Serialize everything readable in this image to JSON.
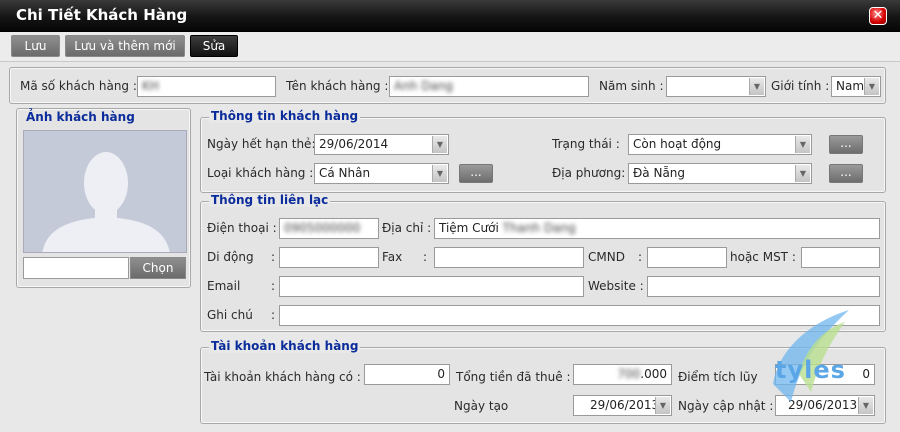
{
  "window": {
    "title": "Chi Tiết Khách Hàng"
  },
  "toolbar": {
    "save": "Lưu",
    "save_new": "Lưu và thêm mới",
    "edit": "Sửa"
  },
  "customer": {
    "code_label": "Mã số khách hàng :",
    "code_value": "KH",
    "name_label": "Tên khách hàng :",
    "name_value": "Anh Dang",
    "birth_label": "Năm sinh :",
    "birth_value": "",
    "gender_label": "Giới tính :",
    "gender_value": "Nam"
  },
  "photo": {
    "title": "Ảnh khách hàng",
    "file_value": "",
    "choose": "Chọn"
  },
  "info": {
    "title": "Thông tin khách hàng",
    "expiry_label": "Ngày hết hạn thẻ:",
    "expiry_value": "29/06/2014",
    "status_label": "Trạng thái :",
    "status_value": "Còn hoạt động",
    "type_label": "Loại khách hàng :",
    "type_value": "Cá Nhân",
    "locality_label": "Địa phương:",
    "locality_value": "Đà Nẵng",
    "ellipsis": "..."
  },
  "contact": {
    "title": "Thông tin liên lạc",
    "phone_label": "Điện thoại :",
    "phone_value": "0905000000",
    "address_label": "Địa chỉ :",
    "address_prefix": "Tiệm Cưới ",
    "address_blur": "Thanh Dang",
    "mobile_label": "Di động",
    "colon": ":",
    "fax_label": "Fax",
    "id_label": "CMND",
    "tax_label": "hoặc MST :",
    "email_label": "Email",
    "website_label": "Website :",
    "note_label": "Ghi chú"
  },
  "account": {
    "title": "Tài khoản khách hàng",
    "balance_label": "Tài khoản khách hàng có :",
    "balance_value": "0",
    "rent_label": "Tổng tiền đã thuê :",
    "rent_blur": "700",
    "rent_suffix": ".000",
    "points_label": "Điểm tích lũy",
    "points_value": "0",
    "created_label": "Ngày tạo",
    "created_value": "29/06/2013",
    "updated_label": "Ngày cập nhật :",
    "updated_value": "29/06/2013"
  },
  "logo": {
    "text": "tyles"
  }
}
